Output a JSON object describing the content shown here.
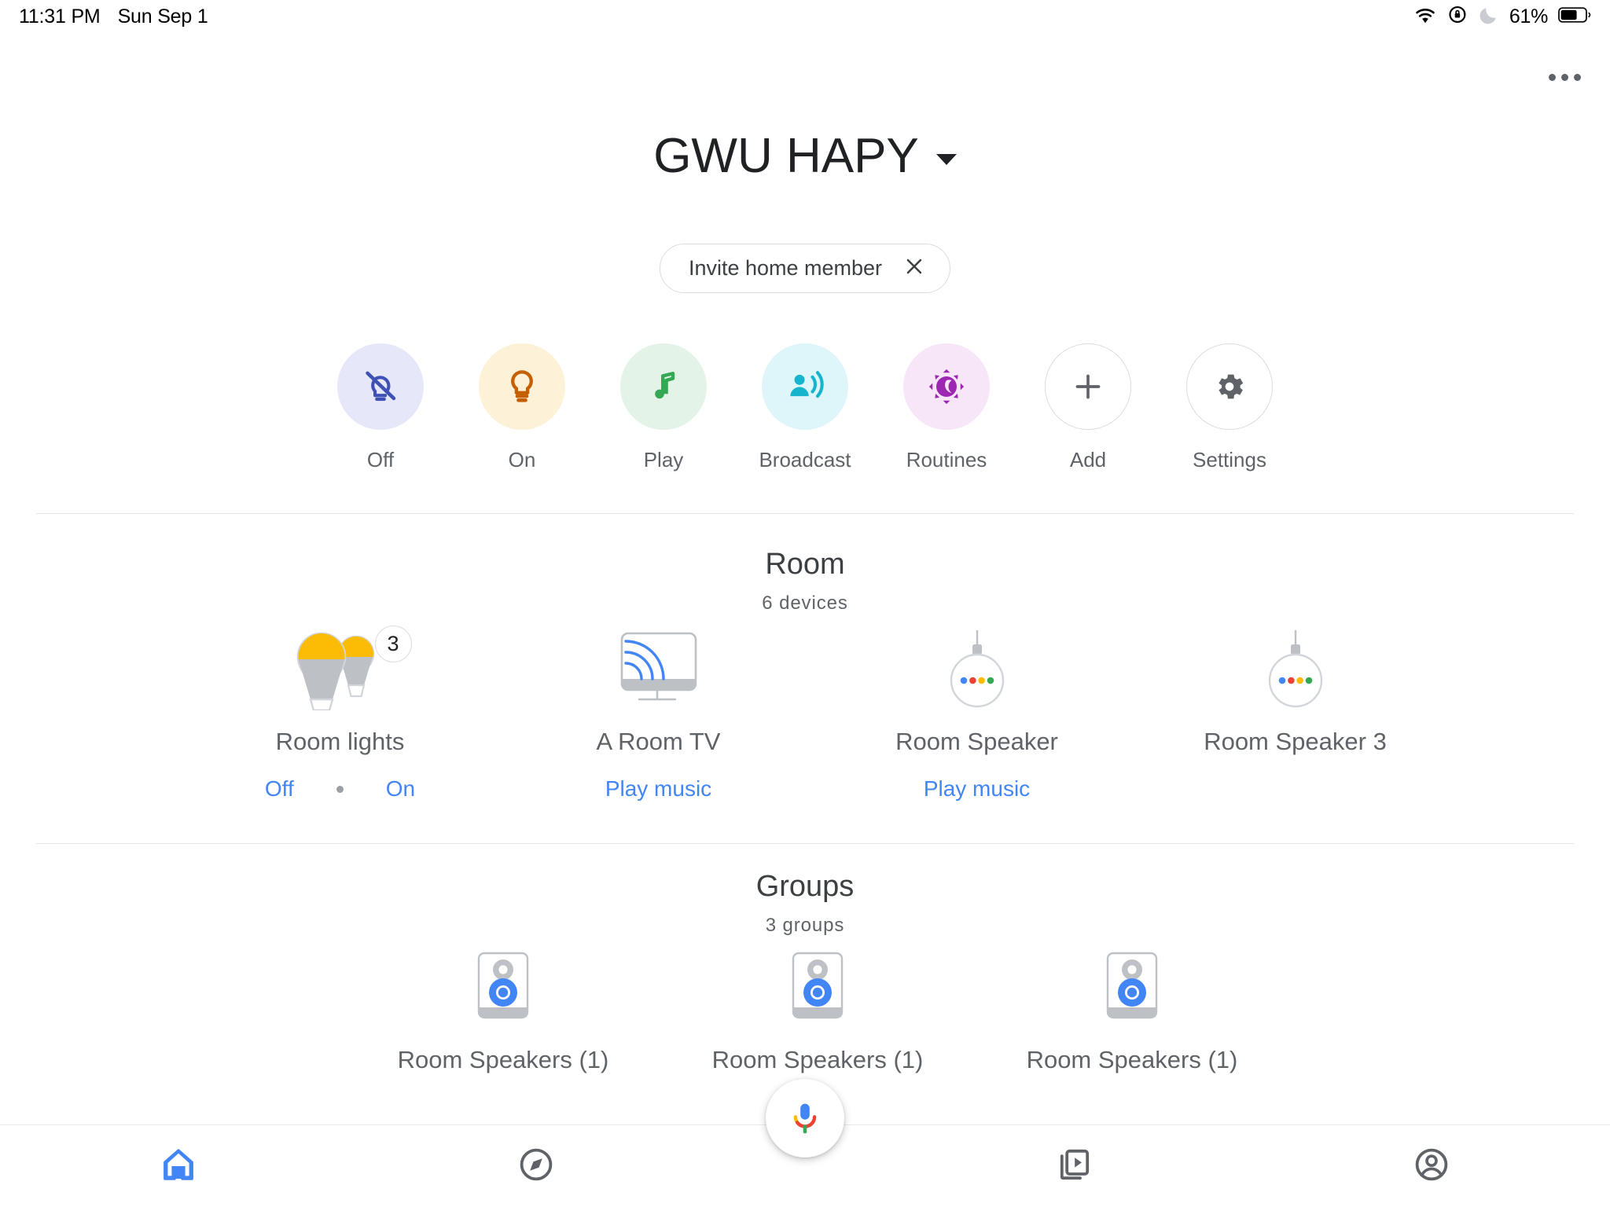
{
  "status_bar": {
    "time": "11:31 PM",
    "date": "Sun Sep 1",
    "battery_percent": "61%",
    "icons": [
      "wifi-icon",
      "rotation-lock-icon",
      "do-not-disturb-moon-icon",
      "battery-icon"
    ]
  },
  "header": {
    "overflow_icon": "more-options-icon",
    "home_title": "GWU HAPY",
    "dropdown_icon": "chevron-down-icon"
  },
  "invite_chip": {
    "label": "Invite home member",
    "close_icon": "close-icon"
  },
  "actions": [
    {
      "label": "Off",
      "icon": "bulb-off-icon",
      "bg": "#e6e7f8",
      "fg": "#3f51b5"
    },
    {
      "label": "On",
      "icon": "bulb-on-icon",
      "bg": "#fdf1d8",
      "fg": "#c56000"
    },
    {
      "label": "Play",
      "icon": "music-note-icon",
      "bg": "#e3f3e7",
      "fg": "#34a853"
    },
    {
      "label": "Broadcast",
      "icon": "broadcast-icon",
      "bg": "#def5fa",
      "fg": "#17b5cd"
    },
    {
      "label": "Routines",
      "icon": "routines-icon",
      "bg": "#f7e6f7",
      "fg": "#9c27b0"
    },
    {
      "label": "Add",
      "icon": "plus-icon",
      "bg": "#ffffff",
      "fg": "#5f6368"
    },
    {
      "label": "Settings",
      "icon": "gear-icon",
      "bg": "#ffffff",
      "fg": "#5f6368"
    }
  ],
  "room_section": {
    "title": "Room",
    "subtitle": "6 devices",
    "devices": [
      {
        "name": "Room lights",
        "icon": "light-bulbs-icon",
        "badge": "3",
        "actions": [
          "Off",
          "On"
        ]
      },
      {
        "name": "A Room TV",
        "icon": "cast-tv-icon",
        "badge": "",
        "actions": [
          "Play music"
        ]
      },
      {
        "name": "Room Speaker",
        "icon": "google-home-mini-icon",
        "badge": "",
        "actions": [
          "Play music"
        ]
      },
      {
        "name": "Room Speaker 3",
        "icon": "google-home-mini-icon",
        "badge": "",
        "actions": []
      }
    ]
  },
  "groups_section": {
    "title": "Groups",
    "subtitle": "3 groups",
    "groups": [
      {
        "name": "Room Speakers (1)",
        "icon": "speaker-group-icon"
      },
      {
        "name": "Room Speakers (1)",
        "icon": "speaker-group-icon"
      },
      {
        "name": "Room Speakers (1)",
        "icon": "speaker-group-icon"
      }
    ]
  },
  "assistant_fab": {
    "icon": "google-assistant-mic-icon"
  },
  "bottom_nav": [
    {
      "icon": "home-icon",
      "active": true
    },
    {
      "icon": "explore-compass-icon",
      "active": false
    },
    {
      "icon": "media-library-icon",
      "active": false
    },
    {
      "icon": "account-icon",
      "active": false
    }
  ],
  "colors": {
    "link_blue": "#4285f4",
    "active_blue": "#4285f4",
    "text_primary": "#202124",
    "text_secondary": "#5f6368",
    "divider": "#e4e6e8"
  }
}
